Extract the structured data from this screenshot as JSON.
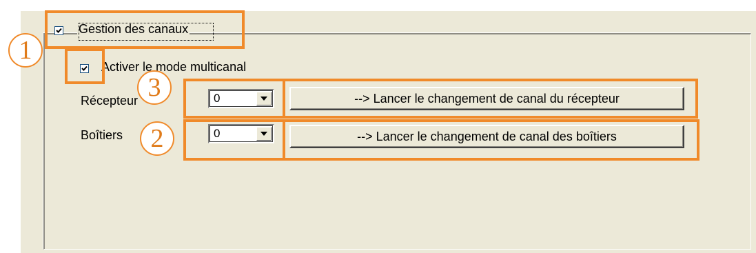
{
  "group": {
    "checkbox_label": "Gestion des canaux",
    "checked": true
  },
  "multichannel": {
    "checkbox_label": "Activer le mode multicanal",
    "checked": true
  },
  "rows": [
    {
      "label": "Récepteur",
      "combo_value": "0",
      "button_label": "--> Lancer le changement de canal du récepteur"
    },
    {
      "label": "Boîtiers",
      "combo_value": "0",
      "button_label": "--> Lancer le changement de canal des boîtiers"
    }
  ],
  "annotations": [
    {
      "number": "1"
    },
    {
      "number": "2"
    },
    {
      "number": "3"
    }
  ],
  "colors": {
    "annotation": "#f08a2a",
    "window_bg": "#ece9d8",
    "checkbox_border": "#1c5180"
  }
}
